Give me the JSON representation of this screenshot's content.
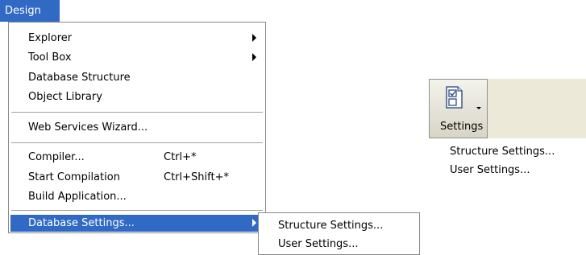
{
  "menubar": {
    "design_label": "Design"
  },
  "design_menu": {
    "items": [
      {
        "label": "Explorer",
        "submenu": true
      },
      {
        "label": "Tool Box",
        "submenu": true
      },
      {
        "label": "Database Structure"
      },
      {
        "label": "Object Library"
      },
      {
        "label": "Web Services Wizard..."
      },
      {
        "label": "Compiler...",
        "shortcut": "Ctrl+*"
      },
      {
        "label": "Start Compilation",
        "shortcut": "Ctrl+Shift+*"
      },
      {
        "label": "Build Application..."
      },
      {
        "label": "Database Settings...",
        "submenu": true,
        "highlighted": true
      }
    ]
  },
  "database_settings_submenu": {
    "items": [
      {
        "label": "Structure Settings..."
      },
      {
        "label": "User Settings..."
      }
    ]
  },
  "toolbar": {
    "settings_button": {
      "label": "Settings",
      "icon": "settings-form-icon"
    },
    "menu_items": [
      {
        "label": "Structure Settings..."
      },
      {
        "label": "User Settings..."
      }
    ]
  },
  "colors": {
    "highlight": "#316ac5",
    "toolbar_bg": "#ece9d8"
  }
}
